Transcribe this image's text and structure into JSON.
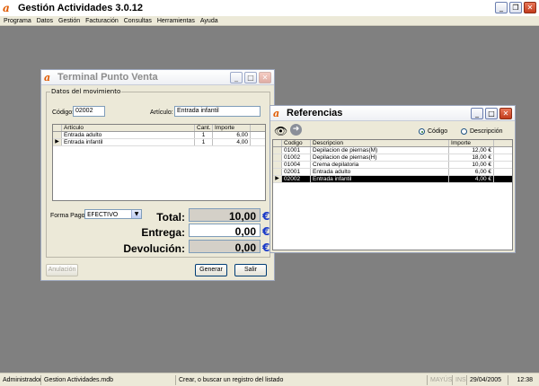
{
  "app": {
    "title": "Gestión Actividades 3.0.12",
    "logo": "a"
  },
  "menu": [
    "Programa",
    "Datos",
    "Gestión",
    "Facturación",
    "Consultas",
    "Herramientas",
    "Ayuda"
  ],
  "terminal": {
    "title": "Terminal Punto Venta",
    "group_label": "Datos del movimiento",
    "codigo_label": "Código:",
    "codigo_value": "02002",
    "articulo_label": "Artículo:",
    "articulo_value": "Entrada infantil",
    "grid": {
      "columns": [
        "Artículo",
        "Cant.",
        "Importe"
      ],
      "rows": [
        {
          "articulo": "Entrada adulto",
          "cant": "1",
          "importe": "6,00"
        },
        {
          "articulo": "Entrada infantil",
          "cant": "1",
          "importe": "4,00",
          "marker": "▶"
        }
      ]
    },
    "forma_pago_label": "Forma Pago:",
    "forma_pago_value": "EFECTIVO",
    "total_label": "Total:",
    "total_value": "10,00",
    "entrega_label": "Entrega:",
    "entrega_value": "0,00",
    "devolucion_label": "Devolución:",
    "devolucion_value": "0,00",
    "currency": "€",
    "anulacion_label": "Anulación",
    "generar_label": "Generar",
    "salir_label": "Salir"
  },
  "referencias": {
    "title": "Referencias",
    "radio_codigo": "Código",
    "radio_descripcion": "Descripción",
    "columns": [
      "Codigo",
      "Descripcion",
      "Importe"
    ],
    "rows": [
      {
        "codigo": "01001",
        "descripcion": "Depilacion de piernas(M)",
        "importe": "12,00 €"
      },
      {
        "codigo": "01002",
        "descripcion": "Depilacion de piernas(H)",
        "importe": "18,00 €"
      },
      {
        "codigo": "01004",
        "descripcion": "Crema depilatoria",
        "importe": "10,00 €"
      },
      {
        "codigo": "02001",
        "descripcion": "Entrada adulto",
        "importe": "6,00 €"
      },
      {
        "codigo": "02002",
        "descripcion": "Entrada infantil",
        "importe": "4,00 €",
        "marker": "▶"
      }
    ]
  },
  "status": {
    "user": "Administrador",
    "db": "Gestion Actividades.mdb",
    "hint": "Crear, o buscar un registro del listado",
    "mayus": "MAYÚS",
    "ins": "INS",
    "date": "29/04/2005",
    "time": "12:38"
  },
  "colors": {
    "accent_orange": "#e05a00",
    "euro_blue": "#1a3ac8",
    "workspace": "#808080"
  }
}
